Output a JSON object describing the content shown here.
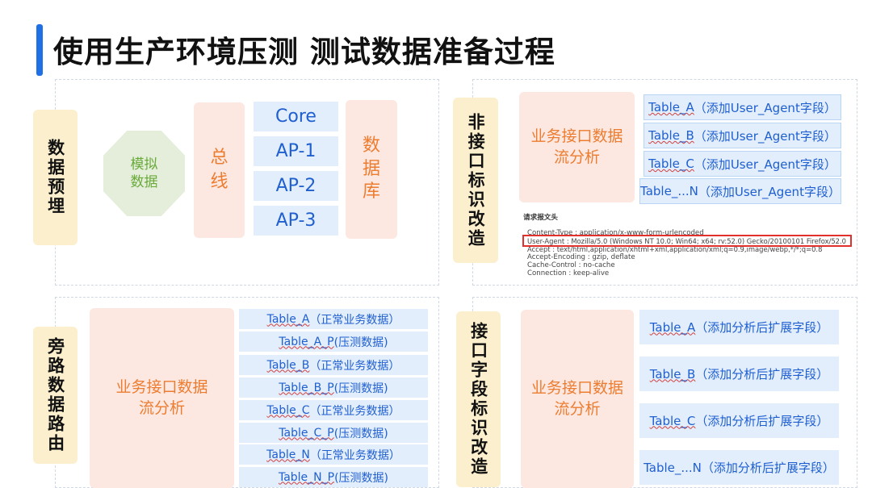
{
  "title": "使用生产环境压测  测试数据准备过程",
  "colors": {
    "accent": "#1f6fe5",
    "label_bg": "#fbefcd",
    "pink_bg": "#fde7e1",
    "pink_text": "#ec7d30",
    "blue_bg": "#e2eefb",
    "blue_text": "#1f5fd0",
    "green_bg": "#e4eedb",
    "green_text": "#6aaa3a"
  },
  "panel1": {
    "label": "数据预埋",
    "mock": "模拟数据",
    "bus": "总线",
    "db": "数据库",
    "systems": [
      "Core",
      "AP-1",
      "AP-2",
      "AP-3"
    ]
  },
  "panel2": {
    "label": "非接口标识改造",
    "analysis": "业务接口数据流分析",
    "tables": [
      {
        "name": "Table_A",
        "note": "（添加User_Agent字段）"
      },
      {
        "name": "Table_B",
        "note": "（添加User_Agent字段）"
      },
      {
        "name": "Table_C",
        "note": "（添加User_Agent字段）"
      },
      {
        "name": "Table_...N",
        "note": "（添加User_Agent字段）"
      }
    ],
    "header_title": "请求报文头",
    "header_lines": [
      "Content-Type : application/x-www-form-urlencoded",
      "User-Agent : Mozilla/5.0 (Windows NT 10.0; Win64; x64; rv:52.0) Gecko/20100101 Firefox/52.0",
      "Accept : text/html,application/xhtml+xml,application/xml;q=0.9,image/webp,*/*;q=0.8",
      "Accept-Encoding : gzip, deflate",
      "Cache-Control : no-cache",
      "Connection : keep-alive"
    ]
  },
  "panel3": {
    "label": "旁路数据路由",
    "analysis": "业务接口数据流分析",
    "tables": [
      {
        "name": "Table_A",
        "note": "（正常业务数据）"
      },
      {
        "name": "Table_A_P",
        "note": "(压测数据)"
      },
      {
        "name": "Table_B",
        "note": "（正常业务数据）"
      },
      {
        "name": "Table_B_P",
        "note": "(压测数据)"
      },
      {
        "name": "Table_C",
        "note": "（正常业务数据）"
      },
      {
        "name": "Table_C_P",
        "note": "(压测数据)"
      },
      {
        "name": "Table_N",
        "note": "（正常业务数据）"
      },
      {
        "name": "Table_N_P",
        "note": "(压测数据)"
      }
    ]
  },
  "panel4": {
    "label": "接口字段标识改造",
    "analysis": "业务接口数据流分析",
    "tables": [
      {
        "name": "Table_A",
        "note": "（添加分析后扩展字段）"
      },
      {
        "name": "Table_B",
        "note": "（添加分析后扩展字段）"
      },
      {
        "name": "Table_C",
        "note": "（添加分析后扩展字段）"
      },
      {
        "name": "Table_...N",
        "note": "（添加分析后扩展字段）"
      }
    ]
  }
}
